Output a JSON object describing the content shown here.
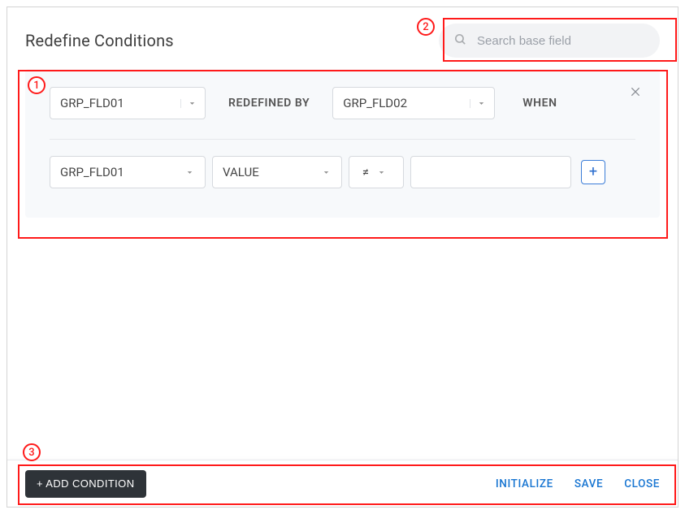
{
  "header": {
    "title": "Redefine Conditions",
    "search_placeholder": "Search base field"
  },
  "condition": {
    "base_field": "GRP_FLD01",
    "redefined_label": "REDEFINED BY",
    "redefined_field": "GRP_FLD02",
    "when_label": "WHEN",
    "row": {
      "field": "GRP_FLD01",
      "type": "VALUE",
      "operator": "≠",
      "value": ""
    }
  },
  "footer": {
    "add_condition": "+ ADD CONDITION",
    "initialize": "INITIALIZE",
    "save": "SAVE",
    "close": "CLOSE"
  },
  "annotations": {
    "a1": "1",
    "a2": "2",
    "a3": "3"
  }
}
